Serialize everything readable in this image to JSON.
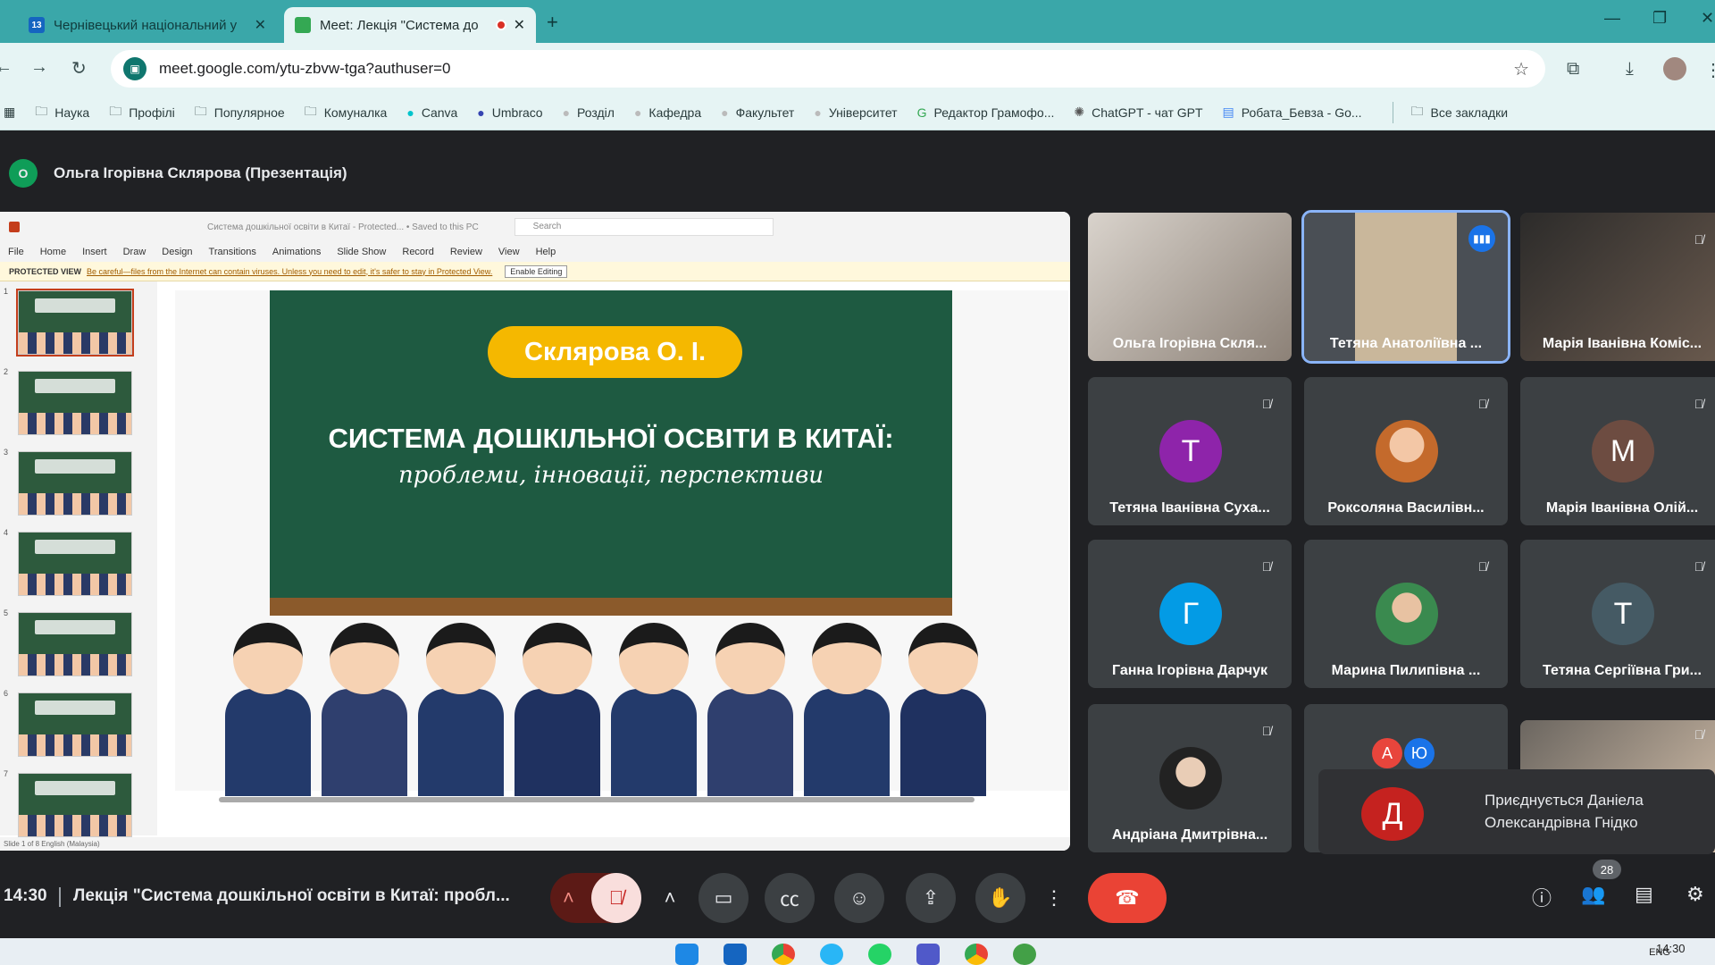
{
  "browser": {
    "tabs": [
      {
        "label": "Чернівецький національний у",
        "fav": "13",
        "active": false
      },
      {
        "label": "Meet: Лекція \"Система до",
        "active": true
      }
    ],
    "new_tab": "+",
    "url": "meet.google.com/ytu-zbvw-tga?authuser=0",
    "bookmarks": [
      "Наука",
      "Профілі",
      "Популярное",
      "Комуналка",
      "Canva",
      "Umbraco",
      "Розділ",
      "Кафедра",
      "Факультет",
      "Університет",
      "Редактор Грамофо...",
      "ChatGPT - чат GPT",
      "Робата_Бевза - Go...",
      "Все закладки"
    ]
  },
  "meet": {
    "presenter_initial": "О",
    "presenter_label": "Ольга Ігорівна Склярова (Презентація)",
    "slide": {
      "menu": [
        "File",
        "Home",
        "Insert",
        "Draw",
        "Design",
        "Transitions",
        "Animations",
        "Slide Show",
        "Record",
        "Review",
        "View",
        "Help"
      ],
      "title_bar": "Система дошкільної освіти в Китаї - Protected... • Saved to this PC",
      "search": "Search",
      "protected_label": "PROTECTED VIEW",
      "protected_text": "Be careful—files from the Internet can contain viruses. Unless you need to edit, it's safer to stay in Protected View.",
      "enable_editing": "Enable Editing",
      "author_pill": "Склярова О. І.",
      "heading": "СИСТЕМА ДОШКІЛЬНОЇ ОСВІТИ В КИТАЇ:",
      "subheading": "проблеми, інновації, перспективи",
      "thumb_numbers": [
        "1",
        "2",
        "3",
        "4",
        "5",
        "6",
        "7"
      ],
      "status": "Slide 1 of 8    English (Malaysia)"
    },
    "participants": [
      {
        "name": "Ольга Ігорівна Скля...",
        "type": "video"
      },
      {
        "name": "Тетяна Анатоліївна ...",
        "type": "video",
        "speaking": true
      },
      {
        "name": "Марія Іванівна Коміс...",
        "type": "video",
        "muted": true
      },
      {
        "name": "Тетяна Іванівна Суха...",
        "initial": "Т",
        "color": "#8e24aa",
        "muted": true
      },
      {
        "name": "Роксоляна Василівн...",
        "type": "photo",
        "muted": true
      },
      {
        "name": "Марія Іванівна Олій...",
        "initial": "М",
        "color": "#6d4c41",
        "muted": true
      },
      {
        "name": "Ганна Ігорівна Дарчук",
        "initial": "Г",
        "color": "#039be5",
        "muted": true
      },
      {
        "name": "Марина Пилипівна ...",
        "type": "photo",
        "muted": true
      },
      {
        "name": "Тетяна Сергіївна Гри...",
        "initial": "Т",
        "color": "#455a64",
        "muted": true
      },
      {
        "name": "Андріана Дмитрівна...",
        "type": "photo",
        "muted": true
      }
    ],
    "joining_initial": "Д",
    "joining_text_1": "Приєднується Даніела",
    "joining_text_2": "Олександрівна Гнідко",
    "group_initials": [
      "А",
      "Ю"
    ],
    "time": "14:30",
    "meeting_title": "Лекція \"Система дошкільної освіти в Китаї: пробл...",
    "participant_count": "28"
  },
  "taskbar": {
    "time": "14:30",
    "lang": "ENG"
  }
}
